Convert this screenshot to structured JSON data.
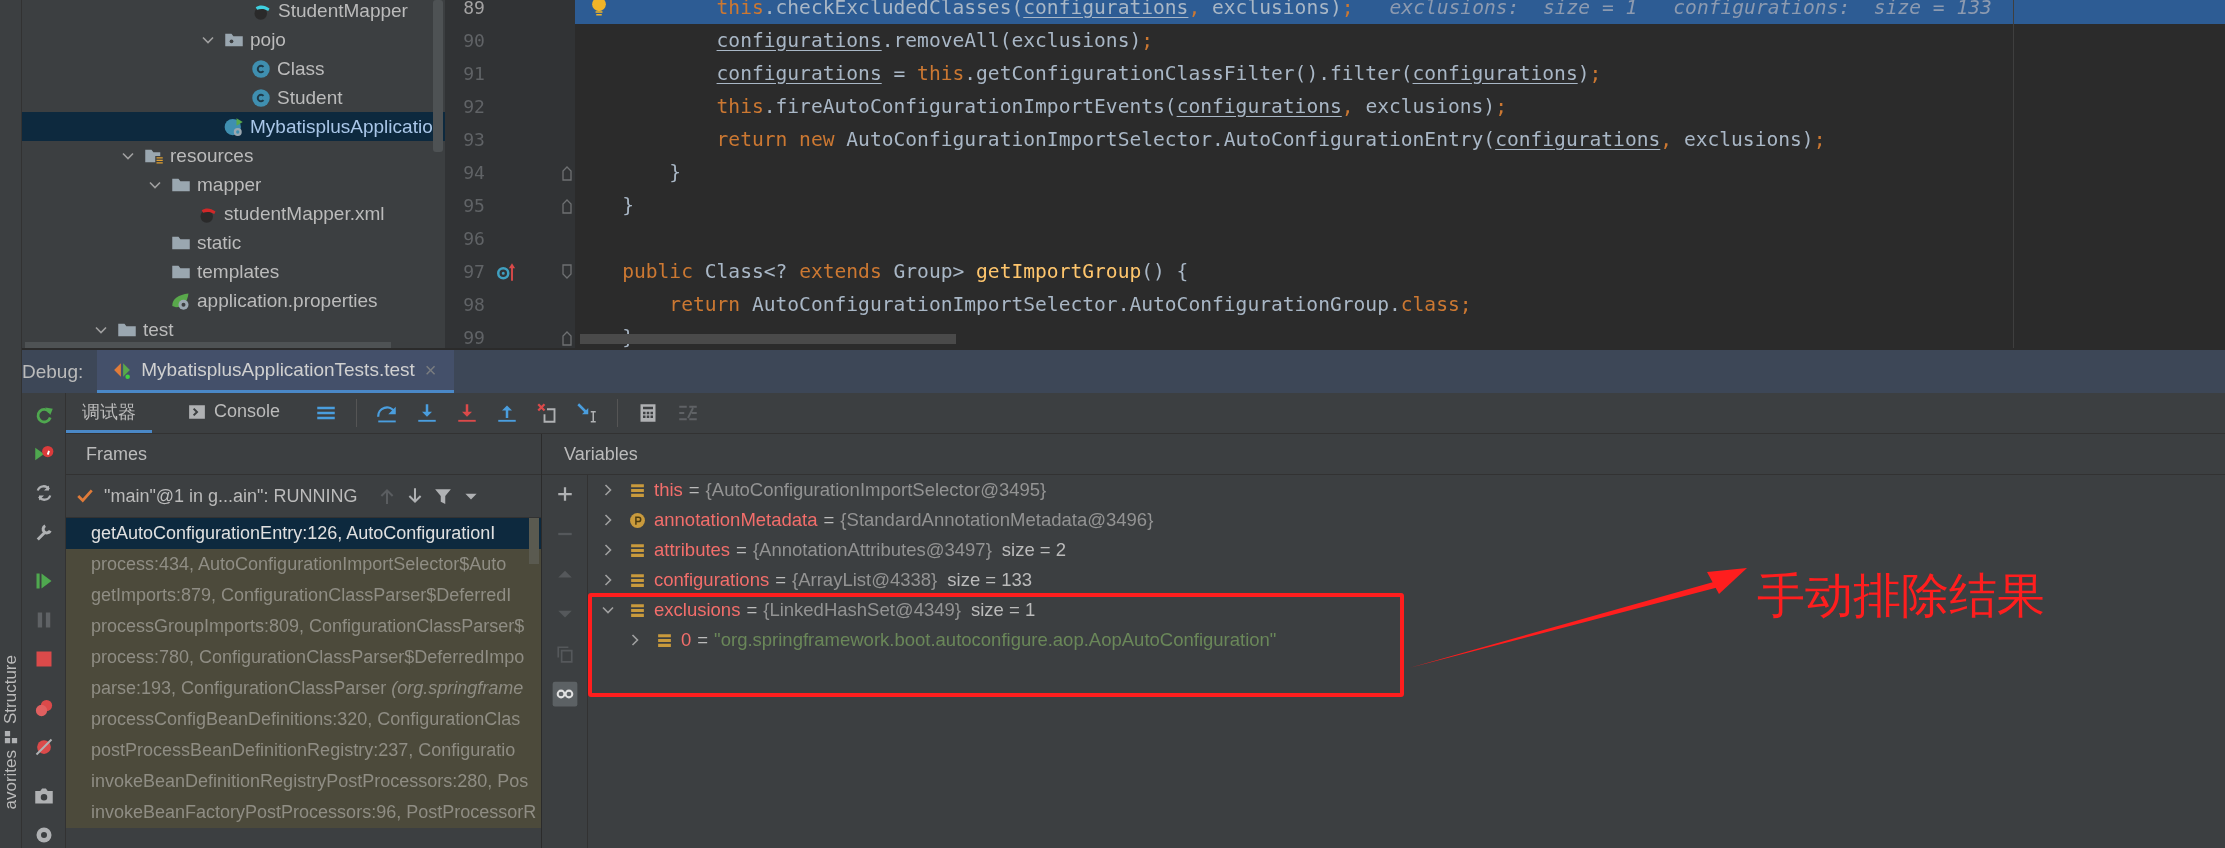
{
  "side_stripe": {
    "labels": [
      "Structure",
      "avorites"
    ]
  },
  "project_tree": {
    "mapper_package_children": [
      {
        "label": "StudentMapper",
        "kind": "mapper-interface",
        "selected": false
      }
    ],
    "package_items": [
      {
        "label": "pojo",
        "kind": "package",
        "expanded": true,
        "selected": false,
        "children": [
          {
            "label": "Class",
            "kind": "class",
            "selected": false
          },
          {
            "label": "Student",
            "kind": "class",
            "selected": false
          }
        ]
      },
      {
        "label": "MybatisplusApplicatio",
        "kind": "spring-app",
        "selected": true
      }
    ],
    "resources": {
      "label": "resources",
      "kind": "resources-folder",
      "expanded": true,
      "selected": false,
      "children": [
        {
          "label": "mapper",
          "kind": "folder",
          "expanded": true,
          "selected": false,
          "children": [
            {
              "label": "studentMapper.xml",
              "kind": "mapper-xml",
              "selected": false
            }
          ]
        },
        {
          "label": "static",
          "kind": "folder",
          "selected": false
        },
        {
          "label": "templates",
          "kind": "folder",
          "selected": false
        },
        {
          "label": "application.properties",
          "kind": "properties",
          "selected": false
        }
      ]
    },
    "test": {
      "label": "test",
      "kind": "folder",
      "expanded": true,
      "selected": false
    }
  },
  "editor": {
    "lines": [
      {
        "number": "89",
        "kind": "statement",
        "current": true,
        "gutter_icon": {
          "kind": "bulb"
        },
        "tokens": [
          {
            "text": "this",
            "kind": "kw"
          },
          {
            "text": ".checkExcludedClasses(",
            "kind": "plain"
          },
          {
            "text": "configurations",
            "kind": "field"
          },
          {
            "text": ", ",
            "kind": "kw"
          },
          {
            "text": "exclusions)",
            "kind": "plain"
          },
          {
            "text": ";",
            "kind": "kw"
          },
          {
            "text": "exclusions:  size = 1",
            "kind": "hint"
          },
          {
            "text": "configurations:  size = 133",
            "kind": "hint"
          }
        ]
      },
      {
        "number": "90",
        "kind": "statement",
        "current": false,
        "tokens": [
          {
            "text": "configurations",
            "kind": "field"
          },
          {
            "text": ".removeAll(exclusions)",
            "kind": "plain"
          },
          {
            "text": ";",
            "kind": "kw"
          }
        ]
      },
      {
        "number": "91",
        "kind": "statement",
        "current": false,
        "tokens": [
          {
            "text": "configurations",
            "kind": "field"
          },
          {
            "text": " = ",
            "kind": "plain"
          },
          {
            "text": "this",
            "kind": "kw"
          },
          {
            "text": ".getConfigurationClassFilter().filter(",
            "kind": "plain"
          },
          {
            "text": "configurations",
            "kind": "field"
          },
          {
            "text": ")",
            "kind": "plain"
          },
          {
            "text": ";",
            "kind": "kw"
          }
        ]
      },
      {
        "number": "92",
        "kind": "statement",
        "current": false,
        "tokens": [
          {
            "text": "this",
            "kind": "kw"
          },
          {
            "text": ".fireAutoConfigurationImportEvents(",
            "kind": "plain"
          },
          {
            "text": "configurations",
            "kind": "field"
          },
          {
            "text": ", ",
            "kind": "kw"
          },
          {
            "text": "exclusions)",
            "kind": "plain"
          },
          {
            "text": ";",
            "kind": "kw"
          }
        ]
      },
      {
        "number": "93",
        "kind": "statement",
        "current": false,
        "tokens": [
          {
            "text": "return new ",
            "kind": "kw"
          },
          {
            "text": "AutoConfigurationImportSelector.AutoConfigurationEntry(",
            "kind": "plain"
          },
          {
            "text": "configurations",
            "kind": "field"
          },
          {
            "text": ", ",
            "kind": "kw"
          },
          {
            "text": "exclusions)",
            "kind": "plain"
          },
          {
            "text": ";",
            "kind": "kw"
          }
        ]
      },
      {
        "number": "94",
        "kind": "block-end",
        "current": false,
        "fold_marker": {
          "kind": "end"
        },
        "tokens": [
          {
            "text": "}",
            "kind": "plain"
          }
        ]
      },
      {
        "number": "95",
        "kind": "member-end",
        "current": false,
        "fold_marker": {
          "kind": "end"
        },
        "tokens": [
          {
            "text": "}",
            "kind": "plain"
          }
        ]
      },
      {
        "number": "96",
        "kind": "blank",
        "current": false
      },
      {
        "number": "97",
        "kind": "member",
        "current": false,
        "gutter_icon": {
          "kind": "override"
        },
        "fold_marker": {
          "kind": "start"
        },
        "tokens": [
          {
            "text": "public ",
            "kind": "kw"
          },
          {
            "text": "Class<? ",
            "kind": "plain"
          },
          {
            "text": "extends ",
            "kind": "kw"
          },
          {
            "text": "Group> ",
            "kind": "plain"
          },
          {
            "text": "getImportGroup",
            "kind": "method"
          },
          {
            "text": "() {",
            "kind": "plain"
          }
        ]
      },
      {
        "number": "98",
        "kind": "member-body",
        "current": false,
        "tokens": [
          {
            "text": "return ",
            "kind": "kw"
          },
          {
            "text": "AutoConfigurationImportSelector.AutoConfigurationGroup.",
            "kind": "plain"
          },
          {
            "text": "class;",
            "kind": "kw"
          }
        ]
      },
      {
        "number": "99",
        "kind": "member-end",
        "current": false,
        "fold_marker": {
          "kind": "end"
        },
        "tokens": [
          {
            "text": "}",
            "kind": "plain"
          }
        ]
      }
    ]
  },
  "debug": {
    "label": "Debug:",
    "session_tab": {
      "title": "MybatisplusApplicationTests.test",
      "selected": true,
      "close": "×"
    },
    "side_tools": [
      {
        "kind": "rerun",
        "disabled": false
      },
      {
        "kind": "rerun-failed",
        "disabled": false
      },
      {
        "kind": "restore",
        "disabled": false
      },
      {
        "kind": "settings",
        "disabled": false
      },
      {
        "kind": "resume",
        "disabled": false
      },
      {
        "kind": "pause",
        "disabled": true
      },
      {
        "kind": "stop",
        "disabled": false
      },
      {
        "kind": "breakpoints",
        "disabled": false
      },
      {
        "kind": "mute",
        "disabled": false
      },
      {
        "kind": "camera",
        "disabled": false
      },
      {
        "kind": "gear",
        "disabled": false
      }
    ],
    "tabs": [
      {
        "label": "调试器",
        "kind": "text",
        "selected": true
      },
      {
        "label": "Console",
        "kind": "console",
        "selected": false
      }
    ],
    "toolbar": [
      {
        "kind": "frames-menu",
        "disabled": false
      },
      {
        "kind": "step-over",
        "disabled": false
      },
      {
        "kind": "step-into",
        "disabled": false
      },
      {
        "kind": "force-step-into",
        "disabled": false
      },
      {
        "kind": "step-out",
        "disabled": false
      },
      {
        "kind": "drop-frame",
        "disabled": false
      },
      {
        "kind": "run-to-cursor",
        "disabled": false
      },
      {
        "kind": "evaluate",
        "disabled": false
      },
      {
        "kind": "trace",
        "disabled": true
      }
    ],
    "frames": {
      "title": "Frames",
      "thread": {
        "text": "\"main\"@1 in g...ain\": RUNNING",
        "up_disabled": true,
        "down_disabled": false
      },
      "items": [
        {
          "text": "getAutoConfigurationEntry:126, AutoConfigurationI",
          "selected": true,
          "library": false
        },
        {
          "text": "process:434, AutoConfigurationImportSelector$Auto",
          "selected": false,
          "library": true
        },
        {
          "text": "getImports:879, ConfigurationClassParser$DeferredI",
          "selected": false,
          "library": true
        },
        {
          "text": "processGroupImports:809, ConfigurationClassParser$",
          "selected": false,
          "library": true
        },
        {
          "text": "process:780, ConfigurationClassParser$DeferredImpo",
          "selected": false,
          "library": true
        },
        {
          "text": "parse:193, ConfigurationClassParser *(org.springframe*",
          "selected": false,
          "library": true
        },
        {
          "text": "processConfigBeanDefinitions:320, ConfigurationClas",
          "selected": false,
          "library": true
        },
        {
          "text": "postProcessBeanDefinitionRegistry:237, Configuratio",
          "selected": false,
          "library": true
        },
        {
          "text": "invokeBeanDefinitionRegistryPostProcessors:280, Pos",
          "selected": false,
          "library": true
        },
        {
          "text": "invokeBeanFactoryPostProcessors:96, PostProcessorR",
          "selected": false,
          "library": true
        }
      ]
    },
    "variables": {
      "title": "Variables",
      "tools": [
        {
          "kind": "add",
          "disabled": false,
          "on": false
        },
        {
          "kind": "remove",
          "disabled": true,
          "on": false
        },
        {
          "kind": "up",
          "disabled": true,
          "on": false
        },
        {
          "kind": "down",
          "disabled": true,
          "on": false
        },
        {
          "kind": "copy",
          "disabled": true,
          "on": false
        },
        {
          "kind": "glasses",
          "disabled": false,
          "on": true
        }
      ],
      "items": [
        {
          "name": "this",
          "kind": "field",
          "equals": "=",
          "value": {
            "text": "{AutoConfigurationImportSelector@3495}",
            "kind": "object"
          },
          "expanded": false
        },
        {
          "name": "annotationMetadata",
          "kind": "param",
          "equals": "=",
          "value": {
            "text": "{StandardAnnotationMetadata@3496}",
            "kind": "object"
          },
          "expanded": false
        },
        {
          "name": "attributes",
          "kind": "field",
          "equals": "=",
          "value": {
            "text": "{AnnotationAttributes@3497}",
            "kind": "object"
          },
          "size": "size = 2",
          "expanded": false
        },
        {
          "name": "configurations",
          "kind": "field",
          "equals": "=",
          "value": {
            "text": "{ArrayList@4338}",
            "kind": "object"
          },
          "size": "size = 133",
          "expanded": false
        },
        {
          "name": "exclusions",
          "kind": "field",
          "equals": "=",
          "value": {
            "text": "{LinkedHashSet@4349}",
            "kind": "object"
          },
          "size": "size = 1",
          "expanded": true,
          "children": [
            {
              "name": "0",
              "kind": "field",
              "equals": "=",
              "value": {
                "text": "\"org.springframework.boot.autoconfigure.aop.AopAutoConfiguration\"",
                "kind": "string"
              },
              "expanded": false
            }
          ]
        }
      ]
    }
  },
  "annotation": {
    "text": "手动排除结果"
  }
}
